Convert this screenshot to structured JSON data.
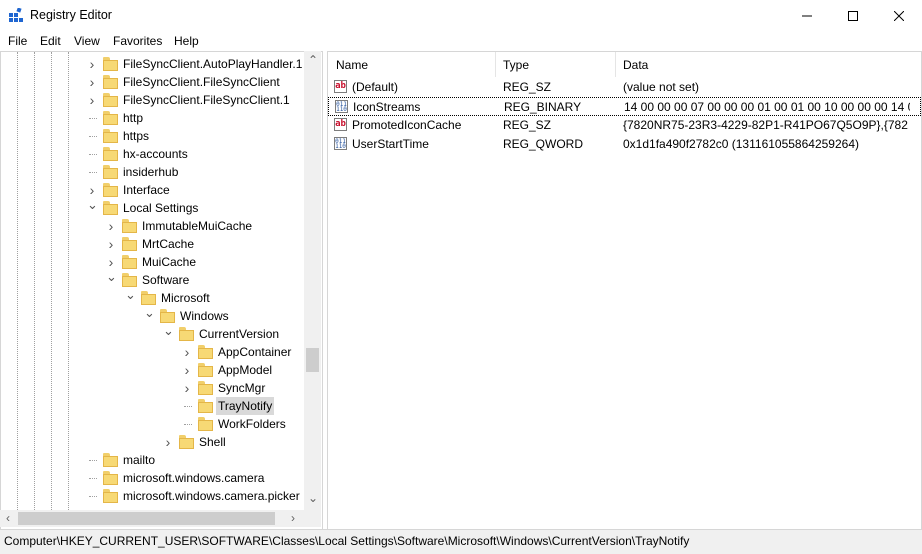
{
  "window": {
    "title": "Registry Editor",
    "icon": "registry-editor-icon",
    "controls": [
      "minimize-icon",
      "maximize-icon",
      "close-icon"
    ]
  },
  "menu": [
    "File",
    "Edit",
    "View",
    "Favorites",
    "Help"
  ],
  "tree": {
    "items": [
      {
        "label": "FileSyncClient.AutoPlayHandler.1",
        "level": 5,
        "expander": "closed"
      },
      {
        "label": "FileSyncClient.FileSyncClient",
        "level": 5,
        "expander": "closed"
      },
      {
        "label": "FileSyncClient.FileSyncClient.1",
        "level": 5,
        "expander": "closed"
      },
      {
        "label": "http",
        "level": 5,
        "expander": "none"
      },
      {
        "label": "https",
        "level": 5,
        "expander": "none"
      },
      {
        "label": "hx-accounts",
        "level": 5,
        "expander": "none"
      },
      {
        "label": "insiderhub",
        "level": 5,
        "expander": "none"
      },
      {
        "label": "Interface",
        "level": 5,
        "expander": "closed"
      },
      {
        "label": "Local Settings",
        "level": 5,
        "expander": "open"
      },
      {
        "label": "ImmutableMuiCache",
        "level": 6,
        "expander": "closed"
      },
      {
        "label": "MrtCache",
        "level": 6,
        "expander": "closed"
      },
      {
        "label": "MuiCache",
        "level": 6,
        "expander": "closed"
      },
      {
        "label": "Software",
        "level": 6,
        "expander": "open"
      },
      {
        "label": "Microsoft",
        "level": 7,
        "expander": "open"
      },
      {
        "label": "Windows",
        "level": 8,
        "expander": "open"
      },
      {
        "label": "CurrentVersion",
        "level": 9,
        "expander": "open"
      },
      {
        "label": "AppContainer",
        "level": 10,
        "expander": "closed"
      },
      {
        "label": "AppModel",
        "level": 10,
        "expander": "closed"
      },
      {
        "label": "SyncMgr",
        "level": 10,
        "expander": "closed"
      },
      {
        "label": "TrayNotify",
        "level": 10,
        "expander": "none",
        "selected": true
      },
      {
        "label": "WorkFolders",
        "level": 10,
        "expander": "none"
      },
      {
        "label": "Shell",
        "level": 9,
        "expander": "closed"
      },
      {
        "label": "mailto",
        "level": 5,
        "expander": "none"
      },
      {
        "label": "microsoft.windows.camera",
        "level": 5,
        "expander": "none"
      },
      {
        "label": "microsoft.windows.camera.picker",
        "level": 5,
        "expander": "none"
      }
    ]
  },
  "list": {
    "columns": [
      "Name",
      "Type",
      "Data"
    ],
    "rows": [
      {
        "icon": "string-value-icon",
        "name": "(Default)",
        "type": "REG_SZ",
        "data": "(value not set)"
      },
      {
        "icon": "binary-value-icon",
        "name": "IconStreams",
        "type": "REG_BINARY",
        "data": "14 00 00 00 07 00 00 00 01 00 01 00 10 00 00 00 14 0...",
        "focused": true
      },
      {
        "icon": "string-value-icon",
        "name": "PromotedIconCache",
        "type": "REG_SZ",
        "data": "{7820NR75-23R3-4229-82P1-R41PO67Q5O9P},{782..."
      },
      {
        "icon": "binary-value-icon",
        "name": "UserStartTime",
        "type": "REG_QWORD",
        "data": "0x1d1fa490f2782c0 (131161055864259264)"
      }
    ]
  },
  "status": {
    "path": "Computer\\HKEY_CURRENT_USER\\SOFTWARE\\Classes\\Local Settings\\Software\\Microsoft\\Windows\\CurrentVersion\\TrayNotify"
  },
  "colors": {
    "selection": "#d9d9d9",
    "folder": "#f7d975",
    "registry_icon_blue": "#1f66d1"
  }
}
